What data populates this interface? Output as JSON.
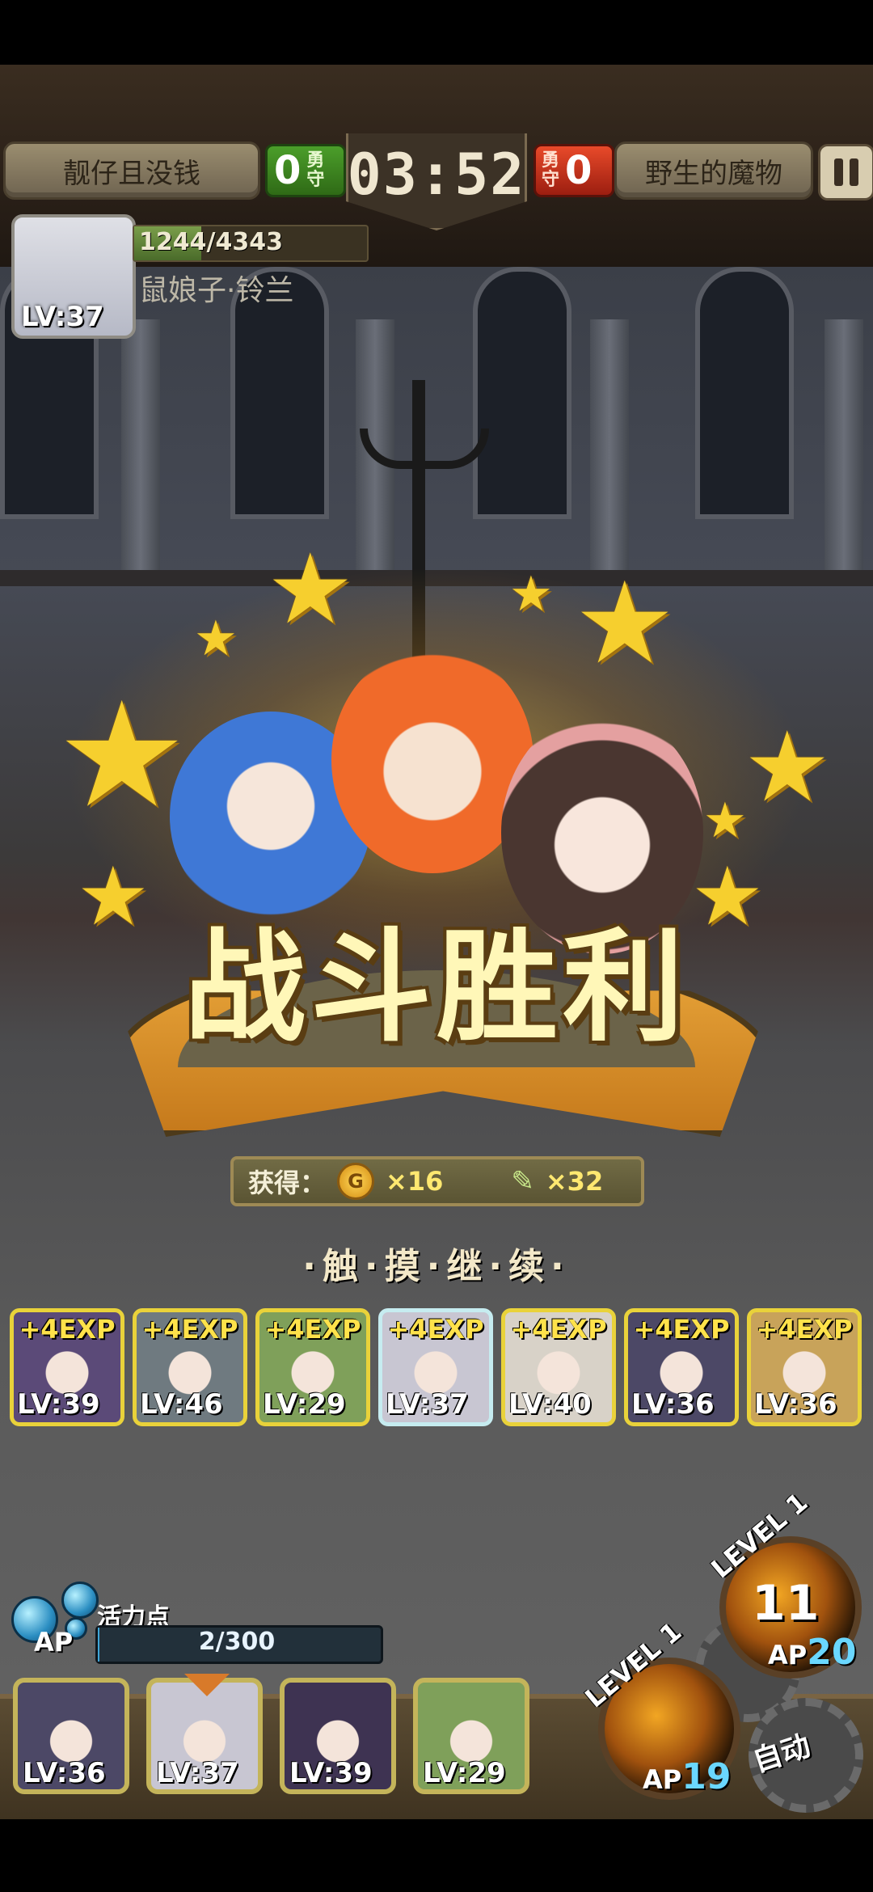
{
  "header": {
    "left_player_name": "靓仔且没钱",
    "left_score": "0",
    "left_score_tag": "勇守",
    "timer": "03:52",
    "right_score": "0",
    "right_score_tag": "勇守",
    "right_player_name": "野生的魔物",
    "pause_icon": "pause-icon"
  },
  "player": {
    "hp_text": "1244/4343",
    "hp_fraction": 0.2865,
    "level": "LV:37",
    "character_name": "鼠娘子·铃兰"
  },
  "victory": {
    "title": "战斗胜利"
  },
  "rewards": {
    "label": "获得：",
    "gold_icon": "G",
    "gold": "×16",
    "feather": "×32"
  },
  "prompt": "·触·摸·继·续·",
  "exp_cards": [
    {
      "gain": "+4EXP",
      "level": "LV:39",
      "color": "#5b4a78"
    },
    {
      "gain": "+4EXP",
      "level": "LV:46",
      "color": "#6f7a80"
    },
    {
      "gain": "+4EXP",
      "level": "LV:29",
      "color": "#7fa05a"
    },
    {
      "gain": "+4EXP",
      "level": "LV:37",
      "color": "#c8c6d2"
    },
    {
      "gain": "+4EXP",
      "level": "LV:40",
      "color": "#d8d2c8"
    },
    {
      "gain": "+4EXP",
      "level": "LV:36",
      "color": "#4c4866"
    },
    {
      "gain": "+4EXP",
      "level": "LV:36",
      "color": "#c8a35a"
    }
  ],
  "hud": {
    "vitality_label": "活力点",
    "ap_tag": "AP",
    "ap_text": "2/300",
    "ap_fraction": 0.0067
  },
  "team": [
    {
      "level": "LV:36",
      "color": "#4c4866"
    },
    {
      "level": "LV:37",
      "color": "#c8c6d2"
    },
    {
      "level": "LV:39",
      "color": "#3e3352"
    },
    {
      "level": "LV:29",
      "color": "#7fa05a"
    }
  ],
  "skills": {
    "skill1_level": "LEVEL 1",
    "skill1_cooldown": "11",
    "skill1_ap_tag": "AP",
    "skill1_ap": "20",
    "skill2_level": "LEVEL 1",
    "skill2_ap_tag": "AP",
    "skill2_ap": "19",
    "auto_label": "自动"
  }
}
